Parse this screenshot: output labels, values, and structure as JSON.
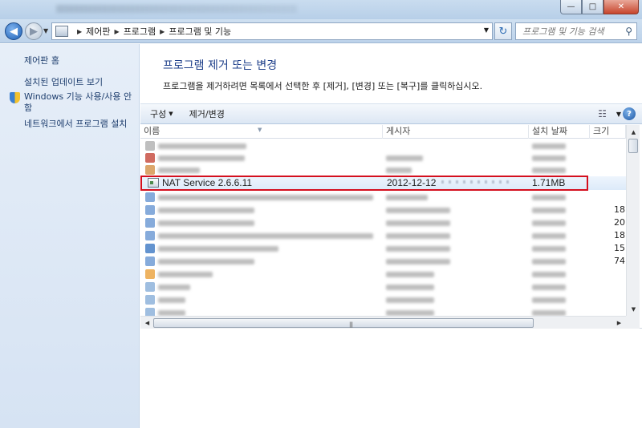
{
  "window": {
    "min_glyph": "—",
    "max_glyph": "□",
    "close_glyph": "✕"
  },
  "address": {
    "crumbs": [
      "제어판",
      "프로그램",
      "프로그램 및 기능"
    ],
    "search_placeholder": "프로그램 및 기능 검색"
  },
  "sidebar": {
    "home": "제어판 홈",
    "links": [
      "설치된 업데이트 보기",
      "Windows 기능 사용/사용 안함",
      "네트워크에서 프로그램 설치"
    ]
  },
  "main": {
    "title": "프로그램 제거 또는 변경",
    "description": "프로그램을 제거하려면 목록에서 선택한 후 [제거], [변경] 또는 [복구]를 클릭하십시오."
  },
  "toolbar": {
    "organize_label": "구성",
    "uninstall_change_label": "제거/변경"
  },
  "columns": [
    "이름",
    "게시자",
    "설치 날짜",
    "크기"
  ],
  "selected_program": {
    "name": "NAT Service 2.6.6.11",
    "install_date": "2012-12-12",
    "size": "1.71MB"
  },
  "visible_sizes": [
    "18.",
    "20.",
    "18.",
    "15",
    "74."
  ],
  "colors": {
    "title_blue": "#1e3f8a",
    "selection_border": "#d40f1e",
    "link_blue": "#1e3e6e"
  }
}
